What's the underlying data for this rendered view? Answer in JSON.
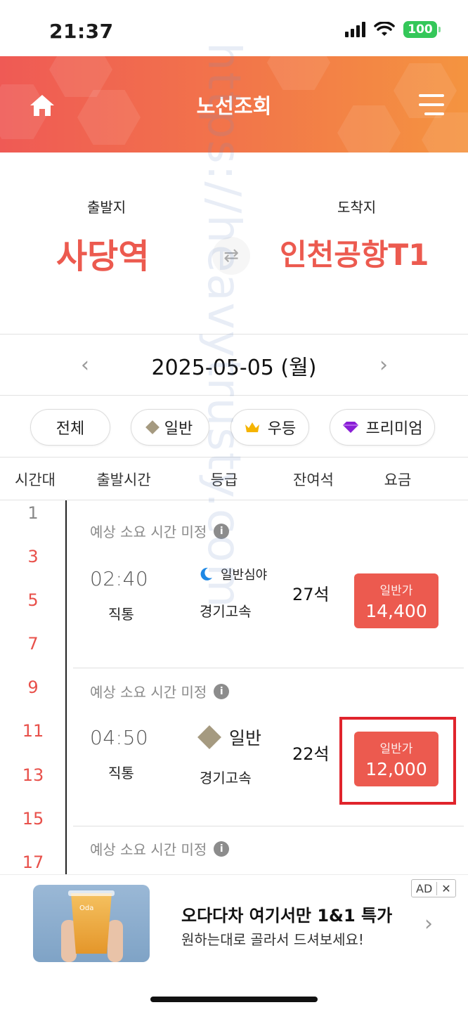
{
  "status_bar": {
    "time": "21:37",
    "battery": "100"
  },
  "header": {
    "title": "노선조회",
    "home_icon": "home-icon",
    "menu_icon": "hamburger-menu-icon"
  },
  "route": {
    "departure_label": "출발지",
    "departure_value": "사당역",
    "arrival_label": "도착지",
    "arrival_value": "인천공항T1",
    "swap_icon": "⇄"
  },
  "date_selector": {
    "date": "2025-05-05 (월)",
    "prev": "‹",
    "next": "›"
  },
  "filters": [
    {
      "label": "전체"
    },
    {
      "label": "일반",
      "icon": "diamond-icon"
    },
    {
      "label": "우등",
      "icon": "crown-icon"
    },
    {
      "label": "프리미엄",
      "icon": "gem-icon"
    }
  ],
  "table_headers": [
    "시간대",
    "출발시간",
    "등급",
    "잔여석",
    "요금"
  ],
  "hours": [
    "1",
    "3",
    "5",
    "7",
    "9",
    "11",
    "13",
    "15",
    "17"
  ],
  "schedules": [
    {
      "eta": "예상 소요 시간 미정",
      "departure_time": "02:40",
      "route_type": "직통",
      "grade": "일반심야",
      "grade_icon": "moon-icon",
      "company": "경기고속",
      "seats": "27석",
      "fare_label": "일반가",
      "fare_price": "14,400"
    },
    {
      "eta": "예상 소요 시간 미정",
      "departure_time": "04:50",
      "route_type": "직통",
      "grade": "일반",
      "grade_icon": "diamond-icon",
      "company": "경기고속",
      "seats": "22석",
      "fare_label": "일반가",
      "fare_price": "12,000"
    },
    {
      "eta": "예상 소요 시간 미정"
    }
  ],
  "ad": {
    "title": "오다다차 여기서만 1&1 특가",
    "subtitle": "원하는대로 골라서 드셔보세요!",
    "badge": "AD",
    "close": "✕",
    "image_text": "Oda"
  },
  "watermark": "https://heavytrusty.com",
  "colors": {
    "accent": "#ec5a4f",
    "header_start": "#ef5a55",
    "header_end": "#f49440",
    "highlight": "#e0242c"
  }
}
